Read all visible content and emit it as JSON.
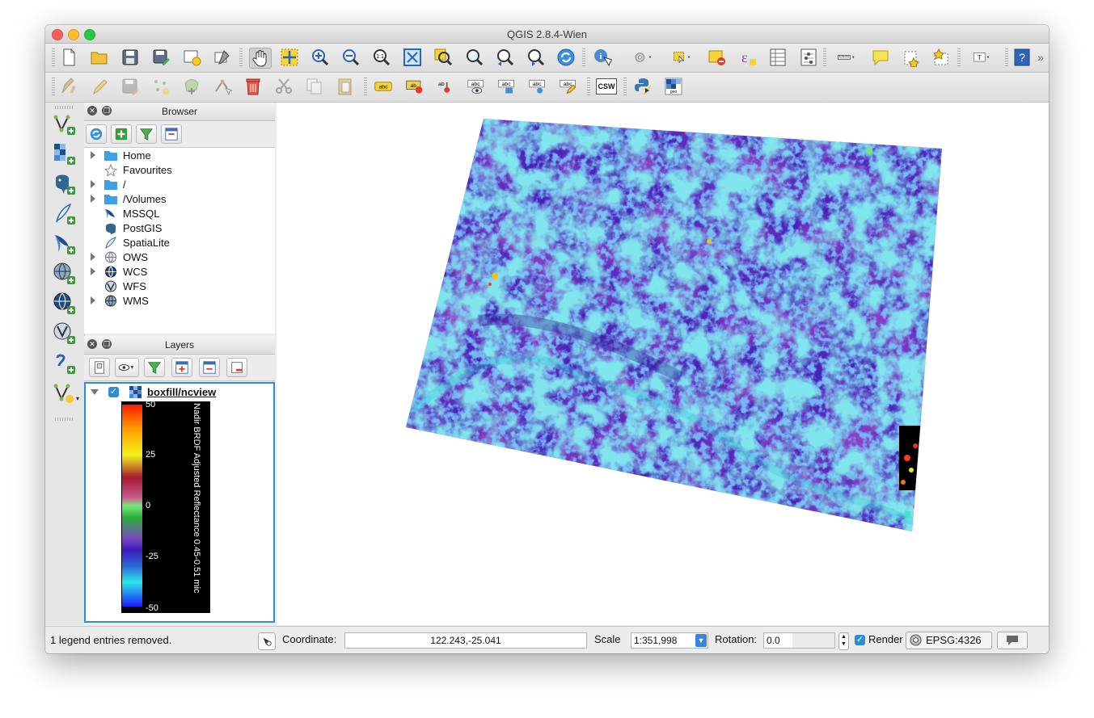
{
  "window": {
    "title": "QGIS 2.8.4-Wien"
  },
  "toolbar1": {
    "icons": [
      "new-project-icon",
      "open-project-icon",
      "save-project-icon",
      "save-as-icon",
      "new-print-composer-icon",
      "composer-manager-icon",
      "pan-icon",
      "pan-to-selection-icon",
      "zoom-in-icon",
      "zoom-out-icon",
      "zoom-actual-size-icon",
      "zoom-full-icon",
      "zoom-to-selection-icon",
      "zoom-to-layer-icon",
      "zoom-last-icon",
      "zoom-next-icon",
      "refresh-icon",
      "identify-icon",
      "run-action-icon",
      "select-features-icon",
      "deselect-icon",
      "field-calculator-icon",
      "attribute-table-icon",
      "statistics-icon",
      "measure-icon",
      "map-tips-icon",
      "new-bookmark-icon",
      "show-bookmarks-icon",
      "text-annotation-icon",
      "help-icon"
    ]
  },
  "toolbar2": {
    "csw_label": "CSW",
    "abc_label": "abc",
    "icons": [
      "current-edits-icon",
      "toggle-editing-icon",
      "save-edits-icon",
      "add-feature-icon",
      "move-feature-icon",
      "node-tool-icon",
      "delete-selected-icon",
      "cut-features-icon",
      "copy-features-icon",
      "paste-features-icon",
      "label-icon",
      "layer-labeling-icon",
      "pin-labels-icon",
      "show-hide-labels-icon",
      "move-label-icon",
      "rotate-label-icon",
      "change-label-icon",
      "metasearch-icon",
      "python-console-icon",
      "geocoder-icon"
    ]
  },
  "leftbar": {
    "icons": [
      "add-vector-layer-icon",
      "add-raster-layer-icon",
      "add-postgis-layer-icon",
      "add-spatialite-layer-icon",
      "add-mssql-layer-icon",
      "add-wms-layer-icon",
      "add-wcs-layer-icon",
      "add-wfs-layer-icon",
      "add-delimited-text-layer-icon",
      "new-shapefile-layer-icon"
    ]
  },
  "browser": {
    "title": "Browser",
    "items": [
      {
        "label": "Home",
        "icon": "folder-icon",
        "expandable": true
      },
      {
        "label": "Favourites",
        "icon": "star-icon",
        "expandable": false
      },
      {
        "label": "/",
        "icon": "folder-icon",
        "expandable": true
      },
      {
        "label": "/Volumes",
        "icon": "folder-icon",
        "expandable": true
      },
      {
        "label": "MSSQL",
        "icon": "mssql-icon",
        "expandable": false
      },
      {
        "label": "PostGIS",
        "icon": "postgis-icon",
        "expandable": false
      },
      {
        "label": "SpatiaLite",
        "icon": "spatialite-icon",
        "expandable": false
      },
      {
        "label": "OWS",
        "icon": "ows-icon",
        "expandable": true
      },
      {
        "label": "WCS",
        "icon": "wcs-icon",
        "expandable": true
      },
      {
        "label": "WFS",
        "icon": "wfs-icon",
        "expandable": false
      },
      {
        "label": "WMS",
        "icon": "wms-icon",
        "expandable": true
      }
    ]
  },
  "layers": {
    "title": "Layers",
    "layer_name": "boxfill/ncview",
    "checked": true,
    "legend": {
      "labels": [
        "50",
        "25",
        "0",
        "-25",
        "-50"
      ],
      "caption": "Nadir BRDF Adjusted Reflectance 0.45-0.51 mic"
    }
  },
  "status": {
    "message": "1 legend entries removed.",
    "coordinate_label": "Coordinate:",
    "coordinate_value": "122.243,-25.041",
    "scale_label": "Scale",
    "scale_value": "1:351,998",
    "rotation_label": "Rotation:",
    "rotation_value": "0.0",
    "render_label": "Render",
    "render_checked": true,
    "crs": "EPSG:4326"
  },
  "colors": {
    "accent_blue": "#2a8fd8",
    "raster_base": "#4b22b8",
    "raster_cyan": "#39c8d8",
    "traffic_close": "#fc5f57",
    "traffic_min": "#fdbc2e",
    "traffic_max": "#28c840"
  }
}
